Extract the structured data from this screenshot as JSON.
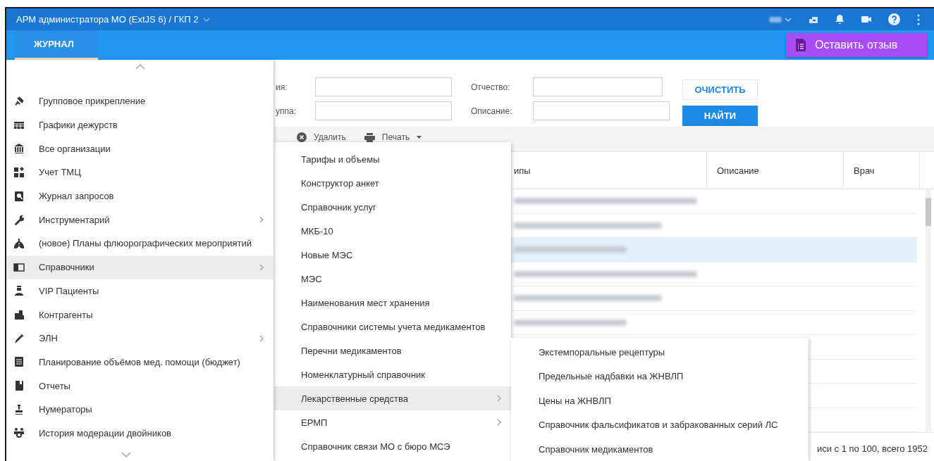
{
  "header": {
    "title": "АРМ администратора МО (ExtJS 6) / ГКП 2"
  },
  "tabs": [
    {
      "label": "ЖУРНАЛ",
      "selected": true
    }
  ],
  "feedback_button": {
    "label": "Оставить отзыв"
  },
  "filter": {
    "fields": [
      {
        "label": "ия:"
      },
      {
        "label": "Отчество:"
      },
      {
        "label": "уппа:"
      },
      {
        "label": "Описание:"
      }
    ],
    "buttons": [
      {
        "label": "ОЧИСТИТЬ",
        "kind": "flat"
      },
      {
        "label": "НАЙТИ",
        "kind": "primary"
      }
    ]
  },
  "toolbar": [
    {
      "label": "Удалить",
      "kind": "delete"
    },
    {
      "label": "Печать",
      "kind": "print"
    }
  ],
  "table": {
    "columns": [
      "ипы",
      "Описание",
      "Врач"
    ],
    "rows": [
      {
        "selected": false,
        "redacted": true
      },
      {
        "selected": false,
        "redacted": true
      },
      {
        "selected": true,
        "redacted": true
      },
      {
        "selected": false,
        "redacted": true
      },
      {
        "selected": false,
        "redacted": true
      },
      {
        "selected": false,
        "redacted": true
      },
      {
        "selected": false
      },
      {
        "selected": false
      },
      {
        "selected": false
      },
      {
        "selected": false
      }
    ]
  },
  "pager": {
    "text": "иси с 1 по 100, всего 1952"
  },
  "main_menu": {
    "items": [
      {
        "label": "Групповое прикрепление",
        "has_submenu": false,
        "selected": false
      },
      {
        "label": "Графики дежурств",
        "has_submenu": false,
        "selected": false
      },
      {
        "label": "Все организации",
        "has_submenu": false,
        "selected": false
      },
      {
        "label": "Учет ТМЦ",
        "has_submenu": false,
        "selected": false
      },
      {
        "label": "Журнал запросов",
        "has_submenu": false,
        "selected": false
      },
      {
        "label": "Инструментарий",
        "has_submenu": true,
        "selected": false
      },
      {
        "label": "(новое) Планы флюорографических мероприятий",
        "has_submenu": false,
        "selected": false
      },
      {
        "label": "Справочники",
        "has_submenu": true,
        "selected": true
      },
      {
        "label": "VIP Пациенты",
        "has_submenu": false,
        "selected": false
      },
      {
        "label": "Контрагенты",
        "has_submenu": false,
        "selected": false
      },
      {
        "label": "ЭЛН",
        "has_submenu": true,
        "selected": false
      },
      {
        "label": "Планирование объёмов мед. помощи (бюджет)",
        "has_submenu": false,
        "selected": false
      },
      {
        "label": "Отчеты",
        "has_submenu": false,
        "selected": false
      },
      {
        "label": "Нумераторы",
        "has_submenu": false,
        "selected": false
      },
      {
        "label": "История модерации двойников",
        "has_submenu": false,
        "selected": false
      }
    ]
  },
  "submenu": {
    "items": [
      {
        "label": "Тарифы и объемы",
        "has_submenu": false,
        "selected": false
      },
      {
        "label": "Конструктор анкет",
        "has_submenu": false,
        "selected": false
      },
      {
        "label": "Справочник услуг",
        "has_submenu": false,
        "selected": false
      },
      {
        "label": "МКБ-10",
        "has_submenu": false,
        "selected": false
      },
      {
        "label": "Новые МЭС",
        "has_submenu": false,
        "selected": false
      },
      {
        "label": "МЭС",
        "has_submenu": false,
        "selected": false
      },
      {
        "label": "Наименования мест хранения",
        "has_submenu": false,
        "selected": false
      },
      {
        "label": "Справочники системы учета медикаментов",
        "has_submenu": false,
        "selected": false
      },
      {
        "label": "Перечни медикаментов",
        "has_submenu": false,
        "selected": false
      },
      {
        "label": "Номенклатурный справочник",
        "has_submenu": false,
        "selected": false
      },
      {
        "label": "Лекарственные средства",
        "has_submenu": true,
        "selected": true
      },
      {
        "label": "ЕРМП",
        "has_submenu": true,
        "selected": false
      },
      {
        "label": "Справочник связи МО с бюро МСЭ",
        "has_submenu": false,
        "selected": false
      }
    ]
  },
  "submenu2": {
    "items": [
      {
        "label": "Экстемпоральные рецептуры",
        "has_submenu": false,
        "selected": false
      },
      {
        "label": "Предельные надбавки на ЖНВЛП",
        "has_submenu": false,
        "selected": false
      },
      {
        "label": "Цены на ЖНВЛП",
        "has_submenu": false,
        "selected": false
      },
      {
        "label": "Справочник фальсификатов и забракованных серий ЛС",
        "has_submenu": false,
        "selected": false
      },
      {
        "label": "Справочник медикаментов",
        "has_submenu": false,
        "selected": false
      }
    ]
  }
}
